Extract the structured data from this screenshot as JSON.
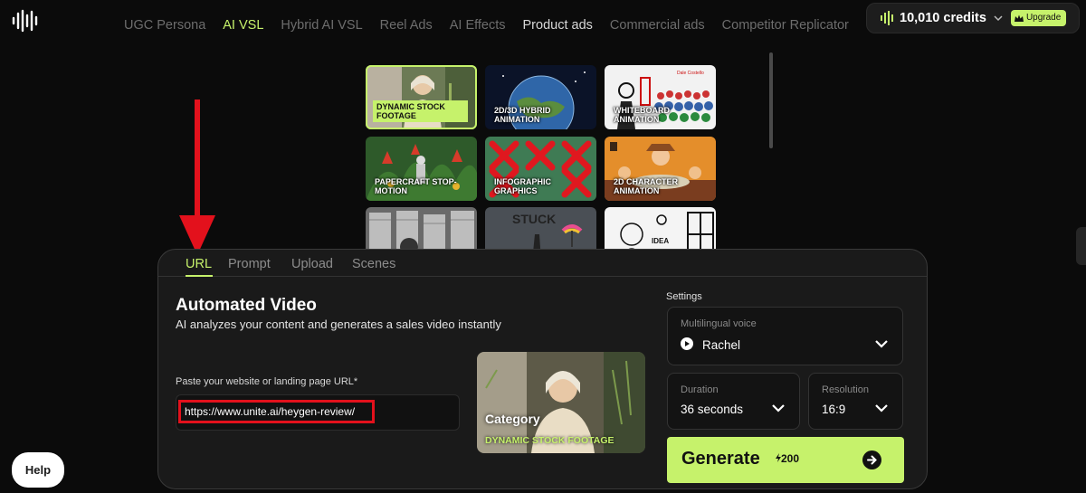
{
  "nav": {
    "items": [
      {
        "label": "UGC Persona",
        "state": "dim"
      },
      {
        "label": "AI VSL",
        "state": "active"
      },
      {
        "label": "Hybrid AI VSL",
        "state": "dim"
      },
      {
        "label": "Reel Ads",
        "state": "dim"
      },
      {
        "label": "AI Effects",
        "state": "dim"
      },
      {
        "label": "Product ads",
        "state": "bright"
      },
      {
        "label": "Commercial ads",
        "state": "dim"
      },
      {
        "label": "Competitor Replicator",
        "state": "dim"
      }
    ]
  },
  "credits": {
    "label": "10,010 credits",
    "upgrade_label": "Upgrade"
  },
  "gallery": {
    "tiles": [
      {
        "label": "DYNAMIC STOCK FOOTAGE",
        "selected": true
      },
      {
        "label": "2D/3D HYBRID ANIMATION",
        "selected": false
      },
      {
        "label": "WHITEBOARD ANIMATION",
        "selected": false
      },
      {
        "label": "PAPERCRAFT STOP-MOTION",
        "selected": false
      },
      {
        "label": "INFOGRAPHIC GRAPHICS",
        "selected": false
      },
      {
        "label": "2D CHARACTER ANIMATION",
        "selected": false
      },
      {
        "label": "",
        "selected": false
      },
      {
        "label": "STUCK",
        "selected": false
      },
      {
        "label": "IDEA",
        "selected": false
      }
    ],
    "whiteboard_caption": "Dale Costello"
  },
  "tabs": [
    {
      "label": "URL",
      "active": true
    },
    {
      "label": "Prompt",
      "active": false
    },
    {
      "label": "Upload",
      "active": false
    },
    {
      "label": "Scenes",
      "active": false
    }
  ],
  "main": {
    "title": "Automated Video",
    "subtitle": "AI analyzes your content and generates a sales video instantly",
    "url_label": "Paste your website or landing page URL*",
    "url_value": "https://www.unite.ai/heygen-review/"
  },
  "category": {
    "title": "Category",
    "value": "DYNAMIC STOCK FOOTAGE"
  },
  "settings": {
    "label": "Settings",
    "voice": {
      "caption": "Multilingual voice",
      "value": "Rachel"
    },
    "duration": {
      "caption": "Duration",
      "value": "36 seconds"
    },
    "resolution": {
      "caption": "Resolution",
      "value": "16:9"
    }
  },
  "generate": {
    "label": "Generate",
    "cost": "200"
  },
  "help": {
    "label": "Help"
  },
  "colors": {
    "accent": "#c6f26b",
    "highlight_red": "#e3111c",
    "background": "#0b0b0b"
  },
  "icons": [
    "waveform-logo-icon",
    "credits-bars-icon",
    "crown-icon",
    "chevron-down-icon",
    "play-icon",
    "bolt-icon",
    "arrow-right-icon",
    "red-annotation-arrow"
  ]
}
